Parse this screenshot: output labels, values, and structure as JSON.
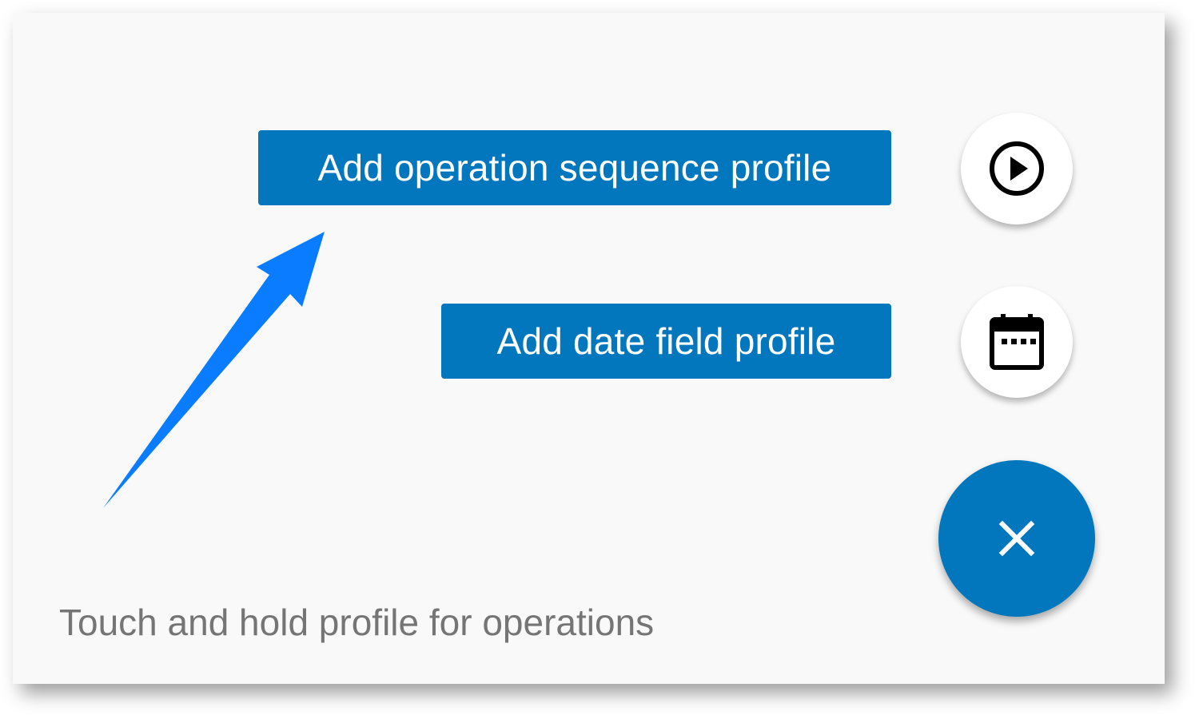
{
  "actions": {
    "sequence_label": "Add operation sequence profile",
    "date_label": "Add date field profile",
    "sequence_icon": "play-circle-icon",
    "date_icon": "calendar-icon",
    "close_icon": "close-icon"
  },
  "hint": {
    "text": "Touch and hold profile for operations"
  },
  "colors": {
    "accent": "#0277bd",
    "annotation_arrow": "#0a7cff",
    "background": "#f9f9f9",
    "hint_text": "#757575"
  }
}
